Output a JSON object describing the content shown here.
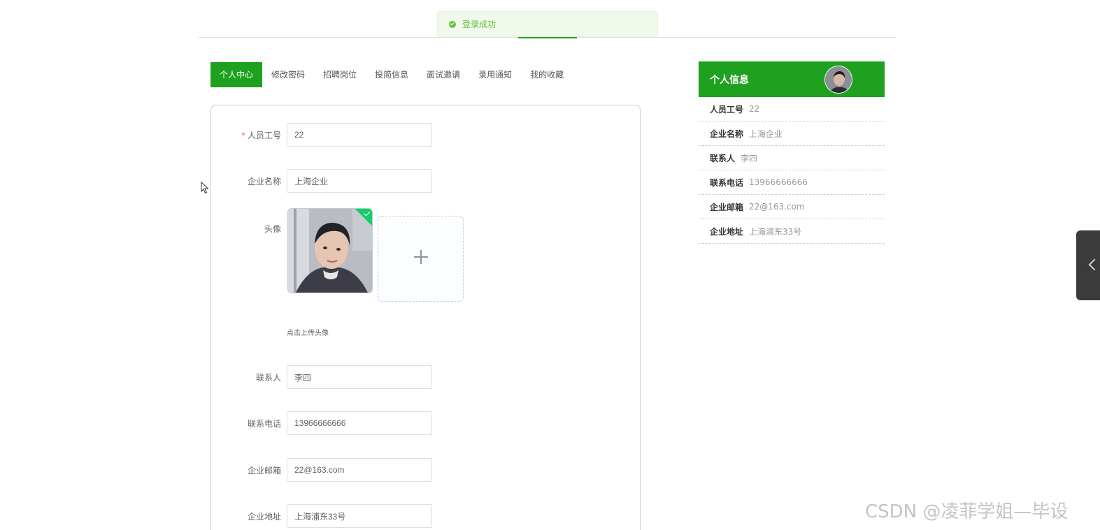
{
  "toast": {
    "text": "登录成功",
    "icon": "success-check-icon",
    "color": "#67c23a"
  },
  "theme": {
    "accent": "#1ea11e"
  },
  "tabs": [
    {
      "label": "个人中心",
      "active": true
    },
    {
      "label": "修改密码",
      "active": false
    },
    {
      "label": "招聘岗位",
      "active": false
    },
    {
      "label": "投简信息",
      "active": false
    },
    {
      "label": "面试邀请",
      "active": false
    },
    {
      "label": "录用通知",
      "active": false
    },
    {
      "label": "我的收藏",
      "active": false
    }
  ],
  "form": {
    "staff_id": {
      "label": "人员工号",
      "required_mark": "*",
      "value": "22"
    },
    "company_name": {
      "label": "企业名称",
      "value": "上海企业"
    },
    "avatar": {
      "label": "头像",
      "upload_tip": "点击上传头像",
      "add_icon": "plus-icon"
    },
    "contact": {
      "label": "联系人",
      "value": "李四"
    },
    "phone": {
      "label": "联系电话",
      "value": "13966666666"
    },
    "email": {
      "label": "企业邮箱",
      "value": "22@163.com"
    },
    "address": {
      "label": "企业地址",
      "value": "上海浦东33号"
    }
  },
  "info_panel": {
    "title": "个人信息",
    "rows": [
      {
        "key": "人员工号",
        "value": "22"
      },
      {
        "key": "企业名称",
        "value": "上海企业"
      },
      {
        "key": "联系人",
        "value": "李四"
      },
      {
        "key": "联系电话",
        "value": "13966666666"
      },
      {
        "key": "企业邮箱",
        "value": "22@163.com"
      },
      {
        "key": "企业地址",
        "value": "上海浦东33号"
      }
    ]
  },
  "side_tab": {
    "icon": "chevron-left-icon"
  },
  "watermark": "CSDN @凌菲学姐—毕设"
}
